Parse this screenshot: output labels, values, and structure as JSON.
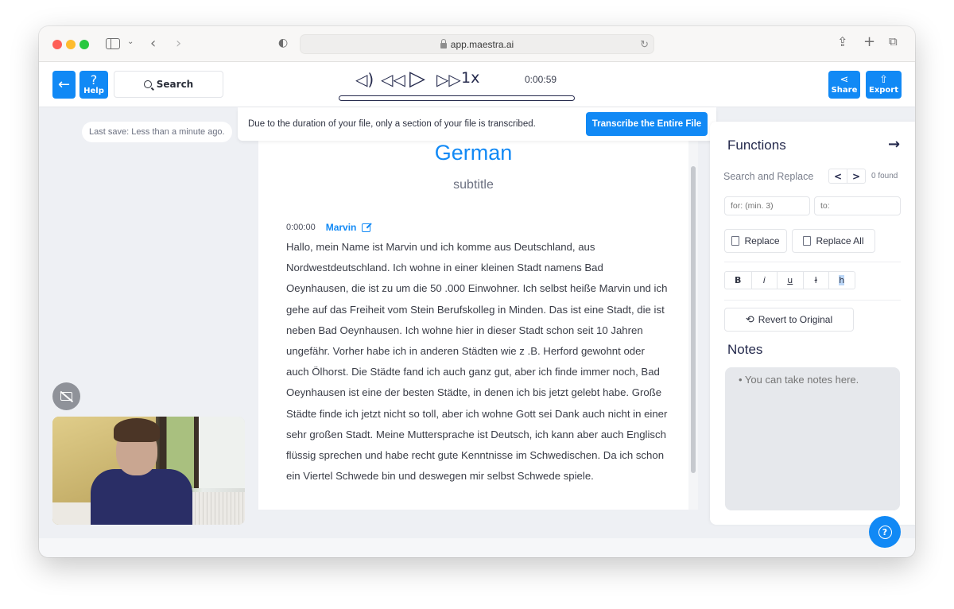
{
  "browser": {
    "url": "app.maestra.ai",
    "icons": [
      "sidebar-icon",
      "chevron-down-icon",
      "back-icon",
      "forward-icon",
      "shield-icon",
      "lock-icon",
      "reload-icon",
      "share-icon",
      "new-tab-icon",
      "tabs-icon"
    ]
  },
  "header": {
    "back_label": "←",
    "help_label": "Help",
    "search_label": "Search",
    "player": {
      "volume_glyph": "🔈",
      "rewind_glyph": "⏪",
      "play_glyph": "▷",
      "forward_glyph": "⏩",
      "speed": "1x",
      "time": "0:00:59",
      "progress_percent": 0
    },
    "share_label": "Share",
    "export_label": "Export"
  },
  "notice": {
    "message": "Due to the duration of your file, only a section of your file is transcribed.",
    "button_label": "Transcribe the Entire File"
  },
  "last_save": "Last save: Less than a minute ago.",
  "document": {
    "title": "German",
    "subtitle": "subtitle",
    "segments": [
      {
        "timestamp": "0:00:00",
        "speaker": "Marvin",
        "text": "Hallo, mein Name ist Marvin und ich komme aus Deutschland, aus Nordwestdeutschland. Ich wohne in einer kleinen Stadt namens Bad Oeynhausen, die ist zu um die 50 .000 Einwohner. Ich selbst heiße Marvin und ich gehe auf das Freiheit vom Stein Berufskolleg in Minden. Das ist eine Stadt, die ist neben Bad Oeynhausen. Ich wohne hier in dieser Stadt schon seit 10 Jahren ungefähr. Vorher habe ich in anderen Städten wie z .B. Herford gewohnt oder auch Ölhorst. Die Städte fand ich auch ganz gut, aber ich finde immer noch, Bad Oeynhausen ist eine der besten Städte, in denen ich bis jetzt gelebt habe. Große Städte finde ich jetzt nicht so toll, aber ich wohne Gott sei Dank auch nicht in einer sehr großen Stadt. Meine Muttersprache ist Deutsch, ich kann aber auch Englisch flüssig sprechen und habe recht gute Kenntnisse im Schwedischen. Da ich schon ein Viertel Schwede bin und deswegen mir selbst Schwede spiele."
      }
    ]
  },
  "functions": {
    "title": "Functions",
    "search_replace": {
      "label": "Search and Replace",
      "prev": "<",
      "next": ">",
      "found": "0 found",
      "for_value": "for: (min. 3)",
      "to_value": "to:",
      "replace_label": "Replace",
      "replace_all_label": "Replace All"
    },
    "formatting": [
      "B",
      "i",
      "u",
      "ŀ",
      "h"
    ],
    "revert_label": "Revert to Original",
    "notes_title": "Notes",
    "notes_placeholder": "• You can take notes here."
  },
  "colors": {
    "accent": "#1189f5",
    "navy": "#252a4d"
  }
}
